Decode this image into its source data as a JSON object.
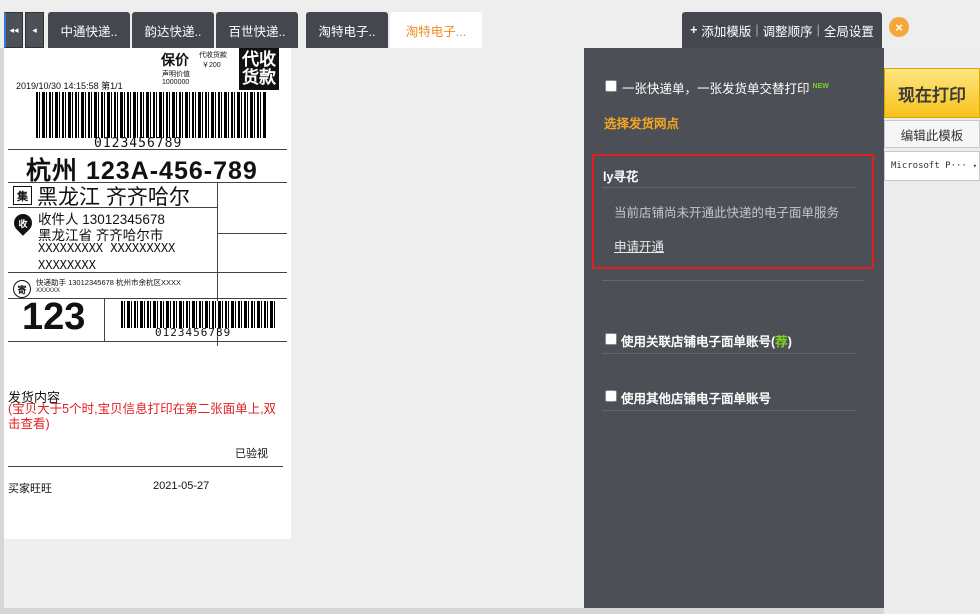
{
  "tabs": {
    "nav_first": "◂◂",
    "nav_prev": "◂",
    "items": [
      "中通快递..",
      "韵达快递..",
      "百世快递..",
      "淘特电子..",
      "淘特电子..."
    ],
    "toolbar": {
      "add_template": "添加模版",
      "adjust_order": "调整顺序",
      "global_settings": "全局设置",
      "separator": "|"
    },
    "close": "×"
  },
  "label": {
    "insured_price": "保价",
    "payment_value": "代收货款",
    "payment_amount": "￥200",
    "declared_value": "声明价值",
    "declared_amount": "1000000",
    "cod_text": "代收货款",
    "datetime": "2019/10/30  14:15:58  第1/1",
    "barcode_number": "0123456789",
    "sort_code": "杭州  123A-456-789",
    "collect_icon": "集",
    "collect_place": "黑龙江  齐齐哈尔",
    "receive_icon": "收",
    "receiver_line": "收件人  13012345678",
    "receiver_addr1": "黑龙江省  齐齐哈尔市",
    "receiver_addr2": "XXXXXXXXX  XXXXXXXXX",
    "receiver_addr3": "XXXXXXXX",
    "send_icon": "寄",
    "sender_line1": "快递助手  13012345678  杭州市余杭区XXXX",
    "sender_line2": "XXXXXX",
    "big_number": "123",
    "barcode_number2": "0123456789",
    "ship_content_title": "发货内容",
    "ship_content_note": "(宝贝大于5个时,宝贝信息打印在第二张面单上,双击查看)",
    "verified": "已验视",
    "buyer": "买家旺旺",
    "date": "2021-05-27"
  },
  "panel": {
    "single_print_label": "一张快递单，一张发货单交替打印",
    "new_badge": "NEW",
    "select_outlet": "选择发货网点",
    "shop_name": "ly寻花",
    "not_opened_msg": "当前店铺尚未开通此快递的电子面单服务",
    "apply_link": "申请开通",
    "linked_account_label": "使用关联店铺电子面单账号(",
    "linked_account_rec": "荐",
    "linked_account_end": ")",
    "other_account_label": "使用其他店铺电子面单账号"
  },
  "actions": {
    "print_now": "现在打印",
    "edit_template": "编辑此模板",
    "printer_value": "Microsoft P···",
    "printer_caret": "▾"
  },
  "colors": {
    "accent_orange": "#f08a1d",
    "print_yellow": "#f7c21c",
    "highlight_red": "#e02020",
    "panel_dark": "#4c4f56"
  }
}
